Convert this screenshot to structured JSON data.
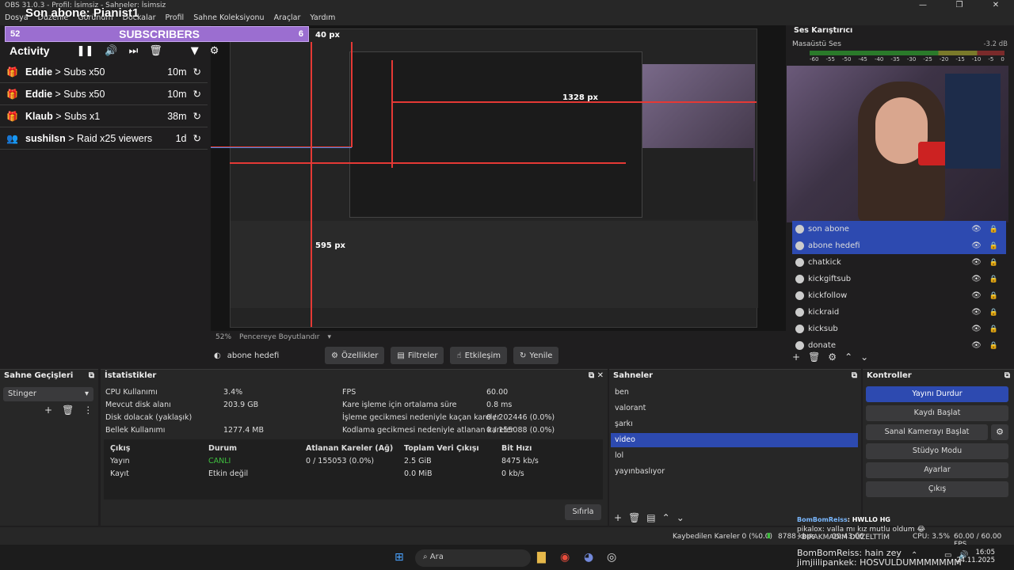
{
  "titlebar": {
    "title": "OBS 31.0.3 - Profil: İsimsiz - Sahneler: İsimsiz",
    "minimize": "—",
    "maximize": "❐",
    "close": "✕"
  },
  "menu": [
    "Dosya",
    "Düzenle",
    "Görünüm",
    "Dockalar",
    "Profil",
    "Sahne Koleksiyonu",
    "Araçlar",
    "Yardım"
  ],
  "overlay": {
    "title": "Son abone: Pianist1",
    "goal_current": "52",
    "goal_label": "SUBSCRIBERS",
    "goal_target": "6",
    "activity_label": "Activity",
    "items": [
      {
        "name": "Eddie",
        "event": "> Subs x50",
        "time": "10m"
      },
      {
        "name": "Eddie",
        "event": "> Subs x50",
        "time": "10m"
      },
      {
        "name": "Klaub",
        "event": "> Subs x1",
        "time": "38m"
      },
      {
        "name": "sushiIsn",
        "event": "> Raid x25 viewers",
        "time": "1d"
      }
    ]
  },
  "preview": {
    "measure_top": "40 px",
    "measure_right": "1328 px",
    "measure_bottom": "595 px"
  },
  "zoom": {
    "level": "52%",
    "label": "Pencereye Boyutlandır"
  },
  "source_toolbar": {
    "selected_source": "abone hedefi",
    "properties": "Özellikler",
    "filters": "Filtreler",
    "interact": "Etkileşim",
    "refresh": "Yenile"
  },
  "mixer": {
    "title": "Ses Karıştırıcı",
    "track": "Masaüstü Ses",
    "db": "-3.2 dB",
    "ticks": [
      "-60",
      "-55",
      "-50",
      "-45",
      "-40",
      "-35",
      "-30",
      "-25",
      "-20",
      "-15",
      "-10",
      "-5",
      "0"
    ]
  },
  "sources": [
    {
      "name": "son abone",
      "selected": true
    },
    {
      "name": "abone hedefi",
      "selected": true
    },
    {
      "name": "chatkick",
      "selected": false
    },
    {
      "name": "kickgiftsub",
      "selected": false
    },
    {
      "name": "kickfollow",
      "selected": false
    },
    {
      "name": "kickraid",
      "selected": false
    },
    {
      "name": "kicksub",
      "selected": false
    },
    {
      "name": "donate",
      "selected": false
    }
  ],
  "transitions": {
    "title": "Sahne Geçişleri",
    "selected": "Stinger"
  },
  "stats": {
    "title": "İstatistikler",
    "rows_left": [
      {
        "label": "CPU Kullanımı",
        "value": "3.4%"
      },
      {
        "label": "Mevcut disk alanı",
        "value": "203.9 GB"
      },
      {
        "label": "Disk dolacak (yaklaşık)",
        "value": ""
      },
      {
        "label": "Bellek Kullanımı",
        "value": "1277.4 MB"
      }
    ],
    "rows_right": [
      {
        "label": "FPS",
        "value": "60.00"
      },
      {
        "label": "Kare işleme için ortalama süre",
        "value": "0.8 ms"
      },
      {
        "label": "İşleme gecikmesi nedeniyle kaçan kareler",
        "value": "0 / 202446 (0.0%)"
      },
      {
        "label": "Kodlama gecikmesi nedeniyle atlanan kareler",
        "value": "0 / 155088 (0.0%)"
      }
    ],
    "table_headers": [
      "Çıkış",
      "Durum",
      "Atlanan Kareler (Ağ)",
      "Toplam Veri Çıkışı",
      "Bit Hızı"
    ],
    "table_rows": [
      [
        "Yayın",
        "CANLI",
        "0 / 155053 (0.0%)",
        "2.5 GiB",
        "8475 kb/s"
      ],
      [
        "Kayıt",
        "Etkin değil",
        "",
        "0.0 MiB",
        "0 kb/s"
      ]
    ],
    "reset": "Sıfırla"
  },
  "scenes": {
    "title": "Sahneler",
    "items": [
      "ben",
      "valorant",
      "şarkı",
      "video",
      "lol",
      "yayınbaslıyor"
    ],
    "selected_index": 3
  },
  "controls": {
    "title": "Kontroller",
    "buttons": [
      "Yayını Durdur",
      "Kaydı Başlat",
      "Sanal Kamerayı Başlat",
      "Stüdyo Modu",
      "Ayarlar",
      "Çıkış"
    ]
  },
  "status": {
    "dropped": "Kaybedilen Kareler 0 (%0.0)",
    "bitrate": "8788 kbps",
    "time": "00:43:06",
    "cpu": "CPU: 3.5%",
    "fps": "60.00 / 60.00 FPS"
  },
  "chat": [
    {
      "user": "BomBomReiss",
      "msg": ": HWLLO HG"
    },
    {
      "user": "pikalox",
      "msg": ": valla mı kız mutlu oldum 😂"
    },
    {
      "user": "",
      "msg": ": BIRAKMADIM DÜZELTTİM"
    },
    {
      "user": "BomBomReiss",
      "msg": ": hain zey"
    },
    {
      "user": "jimjiilipankek",
      "msg": ": HOSVULDUMMMMMMM"
    }
  ],
  "taskbar": {
    "search": "Ara",
    "time": "16:05",
    "date": "24.11.2025"
  }
}
